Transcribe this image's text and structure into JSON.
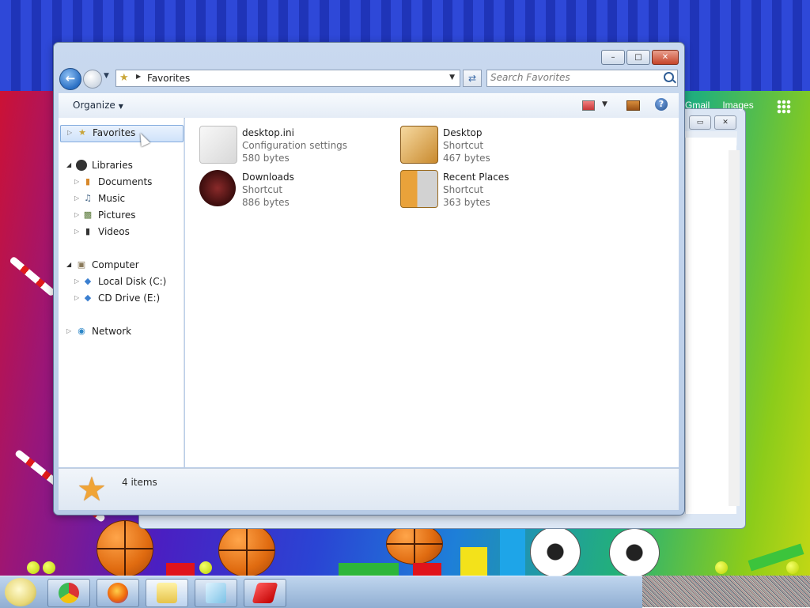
{
  "window": {
    "minimize_glyph": "–",
    "maximize_glyph": "□",
    "close_glyph": "✕"
  },
  "navigation": {
    "back_glyph": "←",
    "address_path": "Favorites",
    "address_icon": "favorites-star-icon",
    "search_placeholder": "Search Favorites"
  },
  "toolbar": {
    "organize_label": "Organize",
    "help_glyph": "?"
  },
  "nav_pane": {
    "favorites": "Favorites",
    "libraries": "Libraries",
    "documents": "Documents",
    "music": "Music",
    "pictures": "Pictures",
    "videos": "Videos",
    "computer": "Computer",
    "local_disk": "Local Disk (C:)",
    "cd_drive": "CD Drive (E:)",
    "network": "Network"
  },
  "files": [
    {
      "name": "desktop.ini",
      "type": "Configuration settings",
      "size": "580 bytes",
      "icon": "settings-file-icon"
    },
    {
      "name": "Desktop",
      "type": "Shortcut",
      "size": "467 bytes",
      "icon": "desktop-shortcut-icon"
    },
    {
      "name": "Downloads",
      "type": "Shortcut",
      "size": "886 bytes",
      "icon": "downloads-shortcut-icon"
    },
    {
      "name": "Recent Places",
      "type": "Shortcut",
      "size": "363 bytes",
      "icon": "recent-places-icon"
    }
  ],
  "details_pane": {
    "count": "4 items"
  },
  "background_window": {
    "links": [
      "Gmail",
      "Images"
    ]
  },
  "taskbar": {
    "apps": [
      "Google Chrome",
      "Firefox",
      "Windows Explorer",
      "Paint",
      "Unknown red app"
    ]
  },
  "colors": {
    "selection_border": "#84acdd",
    "secondary_text": "#6d6d6d",
    "window_frame": "#b7cbe6"
  }
}
